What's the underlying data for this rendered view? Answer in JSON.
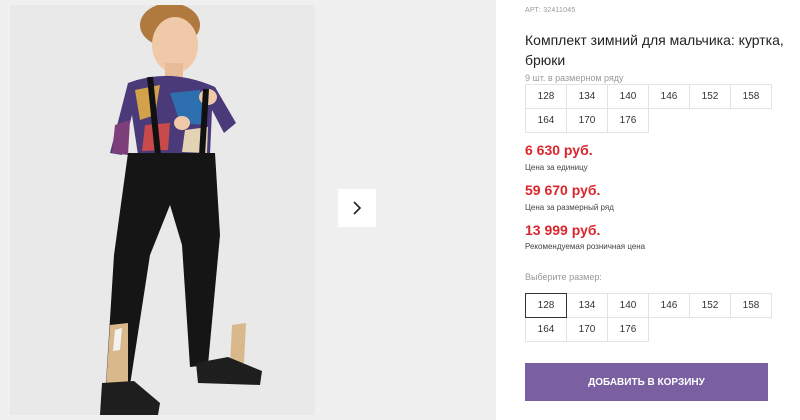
{
  "gallery": {
    "photo_alt": "",
    "next_icon": "chevron-right-icon"
  },
  "product": {
    "sku": "АРТ: 32411045",
    "title": "Комплект зимний для мальчика: куртка, брюки",
    "row_caption": "9 шт. в размерном ряду",
    "row_sizes": [
      "128",
      "134",
      "140",
      "146",
      "152",
      "158",
      "164",
      "170",
      "176"
    ],
    "prices": [
      {
        "value": "6 630 руб.",
        "note": "Цена за единицу"
      },
      {
        "value": "59 670 руб.",
        "note": "Цена за размерный ряд"
      },
      {
        "value": "13 999 руб.",
        "note": "Рекомендуемая розничная цена"
      }
    ],
    "select_caption": "Выберите размер:",
    "select_sizes": [
      "128",
      "134",
      "140",
      "146",
      "152",
      "158",
      "164",
      "170",
      "176"
    ],
    "selected_size": "128",
    "cart_button": "Добавить в корзину"
  },
  "colors": {
    "price": "#d9262c",
    "button": "#7a5fa1"
  }
}
